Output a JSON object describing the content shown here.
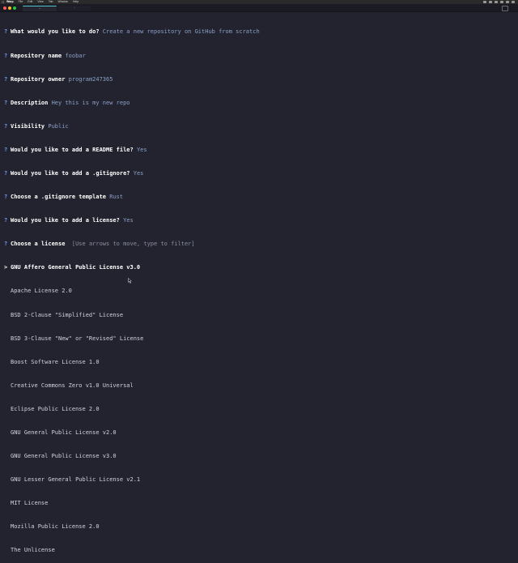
{
  "menubar": {
    "app": "Warp",
    "items": [
      "File",
      "Edit",
      "View",
      "Tab",
      "Window",
      "Help"
    ]
  },
  "tabs": [
    {
      "label": "~"
    },
    {
      "label": "~"
    }
  ],
  "prompts": [
    {
      "question": "What would you like to do?",
      "answer": "Create a new repository on GitHub from scratch"
    },
    {
      "question": "Repository name",
      "answer": "foobar"
    },
    {
      "question": "Repository owner",
      "answer": "program247365"
    },
    {
      "question": "Description",
      "answer": "Hey this is my new repo"
    },
    {
      "question": "Visibility",
      "answer": "Public"
    },
    {
      "question": "Would you like to add a README file?",
      "answer": "Yes"
    },
    {
      "question": "Would you like to add a .gitignore?",
      "answer": "Yes"
    },
    {
      "question": "Choose a .gitignore template",
      "answer": "Rust"
    },
    {
      "question": "Would you like to add a license?",
      "answer": "Yes"
    }
  ],
  "active_prompt": {
    "question": "Choose a license",
    "hint": "[Use arrows to move, type to filter]",
    "pointer": ">"
  },
  "licenses": [
    "GNU Affero General Public License v3.0",
    "Apache License 2.0",
    "BSD 2-Clause \"Simplified\" License",
    "BSD 3-Clause \"New\" or \"Revised\" License",
    "Boost Software License 1.0",
    "Creative Commons Zero v1.0 Universal",
    "Eclipse Public License 2.0",
    "GNU General Public License v2.0",
    "GNU General Public License v3.0",
    "GNU Lesser General Public License v2.1",
    "MIT License",
    "Mozilla Public License 2.0",
    "The Unlicense"
  ],
  "selected_license_index": 0,
  "prompt_marker": "?"
}
